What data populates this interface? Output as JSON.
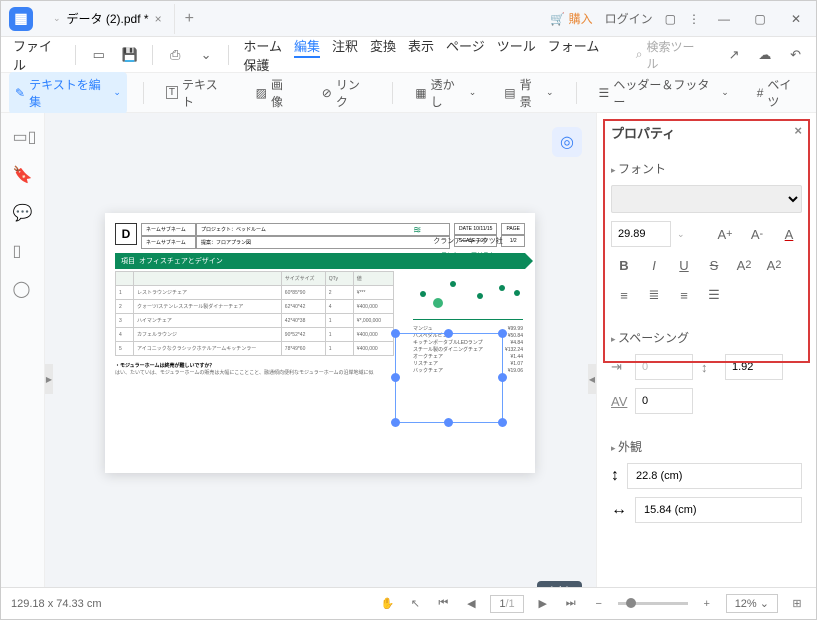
{
  "titlebar": {
    "tab_name": "データ (2).pdf *",
    "buy": "購入",
    "login": "ログイン"
  },
  "menubar": {
    "file": "ファイル",
    "items": [
      "ホーム",
      "編集",
      "注釈",
      "変換",
      "表示",
      "ページ",
      "ツール",
      "フォーム",
      "保護"
    ],
    "active_index": 1,
    "search_placeholder": "検索ツール"
  },
  "toolbar": {
    "edit_text": "テキストを編集",
    "text": "テキスト",
    "image": "画像",
    "link": "リンク",
    "watermark": "透かし",
    "background": "背景",
    "header_footer": "ヘッダー＆フッター",
    "bates": "ベイツ"
  },
  "page_indicator": "1 / 1",
  "doc": {
    "header": {
      "logo": "D",
      "h1a": "ネームサブネーム",
      "h1b": "プロジェクト：ベッドルーム",
      "h2a": "ネームサブネーム",
      "h2b": "提案：フロアプラン図",
      "date_label": "DATE 10/11/15",
      "scale": "SCALE 1:20",
      "page_label": "PAGE",
      "page_frac": "1/2"
    },
    "title_row": {
      "id": "項目",
      "name": "オフィスチェアとデザイン",
      "size": "サイズサイズ",
      "qty": "QTy",
      "price": "値"
    },
    "rows": [
      {
        "id": "1",
        "name": "レストラウンジチェア",
        "size": "60*85*90",
        "qty": "2",
        "price": "¥***"
      },
      {
        "id": "2",
        "name": "クォーツ/ステンレススチール製ダイナーチェア",
        "size": "62*40*42",
        "qty": "4",
        "price": "¥400,000"
      },
      {
        "id": "3",
        "name": "ハイマンチェア",
        "size": "42*40*38",
        "qty": "1",
        "price": "¥*,000,000"
      },
      {
        "id": "4",
        "name": "カフェルラウンジ",
        "size": "90*52*42",
        "qty": "1",
        "price": "¥400,000"
      },
      {
        "id": "5",
        "name": "アイコニックなクラシックホテルアームキッチンラー",
        "size": "78*49*60",
        "qty": "1",
        "price": "¥400,000"
      }
    ],
    "note_label": "・モジュラーホームは終売が難しいですか？",
    "note_text": "はい、たいていは、モジュラーホームの販売は大幅にこことこと、融通傾向便利なモジュラーホームの沿岸地域に似",
    "side": {
      "company": "クランアーキテクツ社",
      "subtitle": "コンシューマリスト",
      "list": [
        {
          "n": "マンジュ",
          "v": "¥99.99"
        },
        {
          "n": "バスペダルビン",
          "v": "¥50.84"
        },
        {
          "n": "キッチンポータブルLEDランプ",
          "v": "¥4.84"
        },
        {
          "n": "スチール製のダイニングチェア",
          "v": "¥132.24"
        },
        {
          "n": "オークチェア",
          "v": "¥1.44"
        },
        {
          "n": "リスチェア",
          "v": "¥1.07"
        },
        {
          "n": "バックチェア",
          "v": "¥19.06"
        }
      ]
    }
  },
  "props": {
    "title": "プロパティ",
    "font_section": "フォント",
    "font_size": "29.89",
    "spacing_section": "スペーシング",
    "indent": "0",
    "line_spacing": "1.92",
    "char_spacing": "0",
    "appearance_section": "外観",
    "width": "22.8 (cm)",
    "height": "15.84 (cm)"
  },
  "statusbar": {
    "coords": "129.18 x 74.33 cm",
    "page": "1",
    "pages": "/1",
    "zoom": "12%"
  }
}
